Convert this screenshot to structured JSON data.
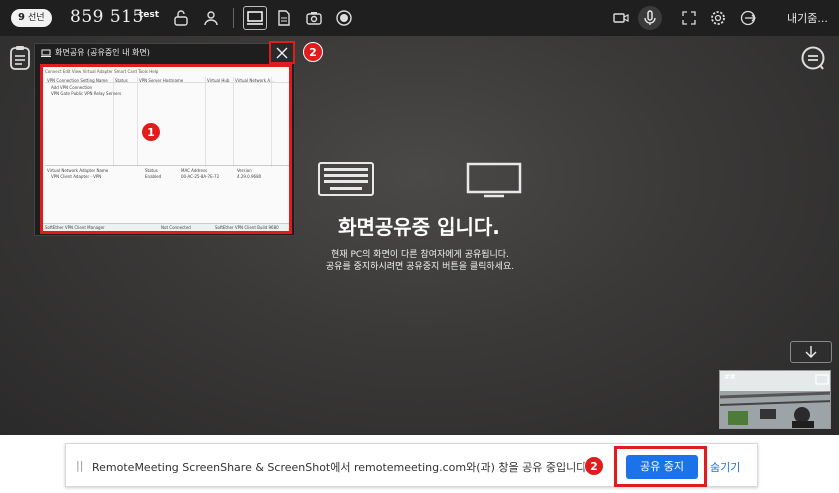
{
  "topbar": {
    "room_badge_num": "9",
    "room_badge_text": "선넌",
    "room_number": "859 515",
    "room_name": "test",
    "leave_label": "내기줌..."
  },
  "preview": {
    "title": "화면공유 (공유중인 내 화면)",
    "thumb_menu": "Connect  Edit  View  Virtual Adapter  Smart Card  Tools  Help",
    "thumb_head_1": "VPN Connection Setting Name",
    "thumb_head_2": "Status",
    "thumb_head_3": "VPN Server Hostname",
    "thumb_head_4": "Virtual Hub",
    "thumb_head_5": "Virtual Network A...",
    "thumb_row_1": "Add VPN Connection",
    "thumb_row_2": "VPN Gate Public VPN Relay Servers",
    "thumb_head2_1": "Virtual Network Adapter Name",
    "thumb_head2_2": "Status",
    "thumb_head2_3": "MAC Address",
    "thumb_head2_4": "Version",
    "thumb_row2_1": "VPN Client Adapter - VPN",
    "thumb_row2_2": "Enabled",
    "thumb_row2_3": "00-AC-25-8A-7E-72",
    "thumb_row2_4": "4.29.0.9680",
    "thumb_status_1": "SoftEther VPN Client Manager",
    "thumb_status_2": "Not Connected",
    "thumb_status_3": "SoftEther VPN Client Build 9680"
  },
  "badges": {
    "one": "1",
    "two": "2"
  },
  "center": {
    "title": "화면공유중 입니다.",
    "line1": "현재 PC의 화면이 다른 참여자에게 공유됩니다.",
    "line2": "공유를 중지하시려면 공유중지 버튼을 클릭하세요."
  },
  "video": {
    "label": "##"
  },
  "notice": {
    "handle": "||",
    "text": "RemoteMeeting ScreenShare & ScreenShot에서 remotemeeting.com와(과) 창을 공유 중입니다.",
    "stop_label": "공유 중지",
    "hide_label": "숨기기"
  },
  "colors": {
    "highlight": "#e21c1c",
    "button_blue": "#1a73e8",
    "topbar": "#1f1f1f"
  }
}
